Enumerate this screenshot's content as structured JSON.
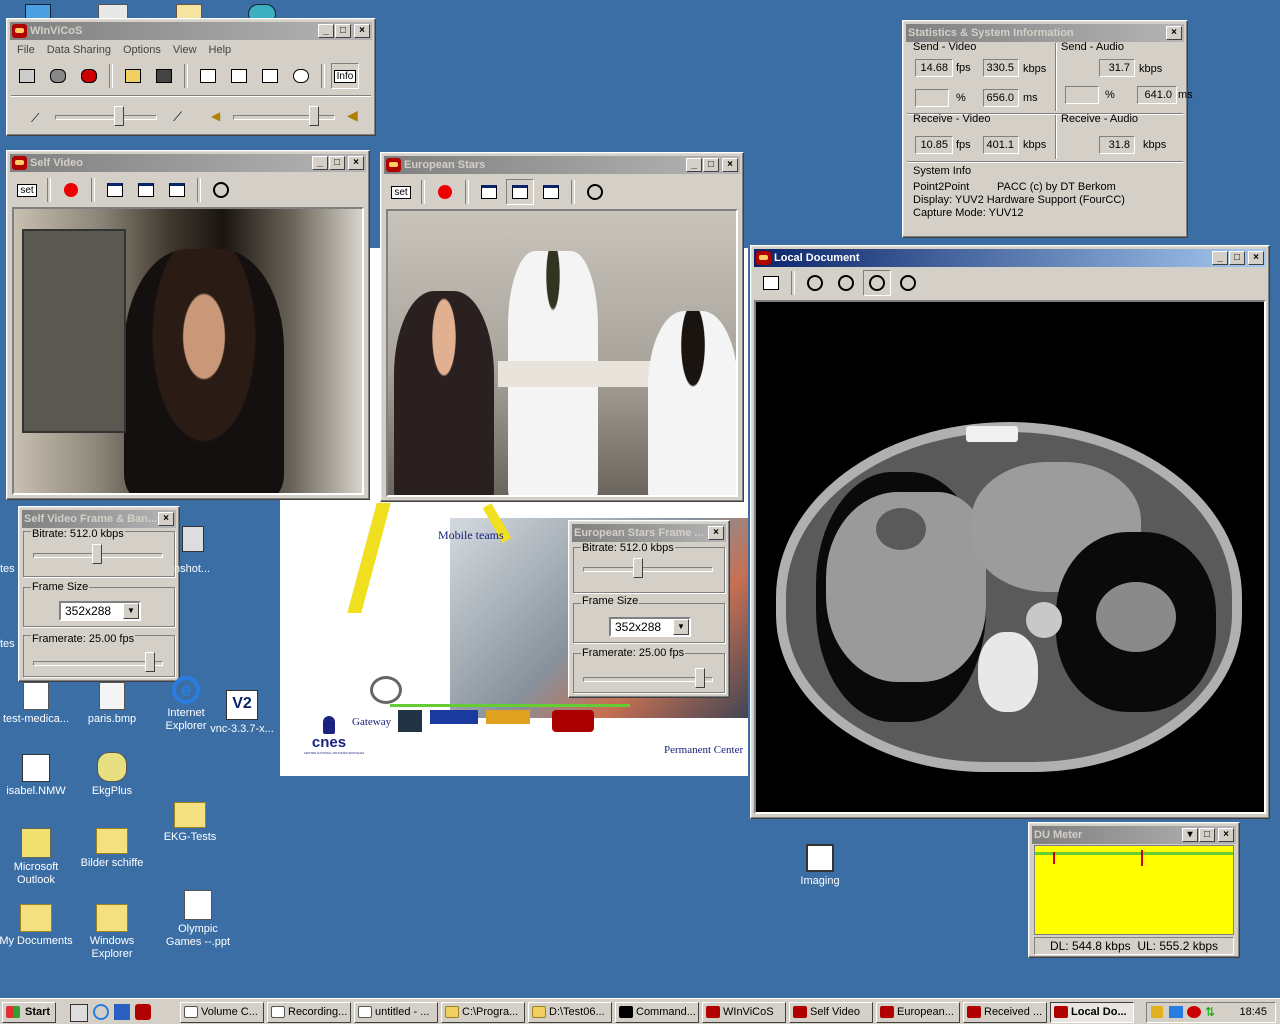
{
  "colors": {
    "desktop": "#3a6ea5",
    "active_title": "#0a246a",
    "du_graph": "#ffff00"
  },
  "winvicos": {
    "title": "WInViCoS",
    "menu": [
      "File",
      "Data Sharing",
      "Options",
      "View",
      "Help"
    ],
    "info_label": "Info"
  },
  "self_video": {
    "title": "Self Video",
    "set_label": "set"
  },
  "european_stars": {
    "title": "European Stars",
    "set_label": "set"
  },
  "stats": {
    "title": "Statistics & System Information",
    "send_video": {
      "label": "Send - Video",
      "fps": "14.68",
      "fps_unit": "fps",
      "kbps": "330.5",
      "kbps_unit": "kbps",
      "pct": "",
      "pct_unit": "%",
      "ms": "656.0",
      "ms_unit": "ms"
    },
    "send_audio": {
      "label": "Send - Audio",
      "kbps": "31.7",
      "kbps_unit": "kbps",
      "pct": "",
      "pct_unit": "%",
      "ms": "641.0",
      "ms_unit": "ms"
    },
    "receive_video": {
      "label": "Receive - Video",
      "fps": "10.85",
      "fps_unit": "fps",
      "kbps": "401.1",
      "kbps_unit": "kbps"
    },
    "receive_audio": {
      "label": "Receive - Audio",
      "kbps": "31.8",
      "kbps_unit": "kbps"
    },
    "system_info": {
      "label": "System Info",
      "line1_a": "Point2Point",
      "line1_b": "PACC (c) by DT Berkom",
      "line2": "Display: YUV2 Hardware Support (FourCC)",
      "line3": "Capture Mode: YUV12"
    }
  },
  "local_document": {
    "title": "Local Document"
  },
  "self_frame": {
    "title": "Self Video Frame & Ban...",
    "bitrate": "Bitrate: 512.0 kbps",
    "frame_size_label": "Frame Size",
    "frame_size": "352x288",
    "framerate": "Framerate: 25.00 fps",
    "bitrate_level": 0.5,
    "framerate_level": 0.95
  },
  "eu_frame": {
    "title": "European Stars Frame ...",
    "bitrate": "Bitrate: 512.0 kbps",
    "frame_size_label": "Frame Size",
    "frame_size": "352x288",
    "framerate": "Framerate: 25.00 fps",
    "bitrate_level": 0.42,
    "framerate_level": 0.95
  },
  "du_meter": {
    "title": "DU Meter",
    "status": "DL: 544.8 kbps  UL: 555.2 kbps"
  },
  "background_doc": {
    "mobile_teams": "Mobile teams",
    "gateway": "Gateway",
    "permanent_center": "Permanent Center",
    "cnes": "cnes",
    "cnes_sub": "CENTRE NATIONAL D'ETUDES SPATIALES"
  },
  "desktop_icons": [
    {
      "label": "tes"
    },
    {
      "label": "tes"
    },
    {
      "label": "nshot..."
    },
    {
      "label": "test-medica..."
    },
    {
      "label": "paris.bmp"
    },
    {
      "label": "Internet Explorer"
    },
    {
      "label": "vnc-3.3.7-x..."
    },
    {
      "label": "isabel.NMW"
    },
    {
      "label": "EkgPlus"
    },
    {
      "label": "Microsoft Outlook"
    },
    {
      "label": "Bilder schiffe"
    },
    {
      "label": "EKG-Tests"
    },
    {
      "label": "My Documents"
    },
    {
      "label": "Windows Explorer"
    },
    {
      "label": "Olympic Games --.ppt"
    },
    {
      "label": "Imaging"
    }
  ],
  "taskbar": {
    "start": "Start",
    "items": [
      "Volume C...",
      "Recording...",
      "untitled - ...",
      "C:\\Progra...",
      "D:\\Test06...",
      "Command...",
      "WInViCoS",
      "Self Video",
      "European...",
      "Received ...",
      "Local Do..."
    ],
    "clock": "18:45"
  }
}
